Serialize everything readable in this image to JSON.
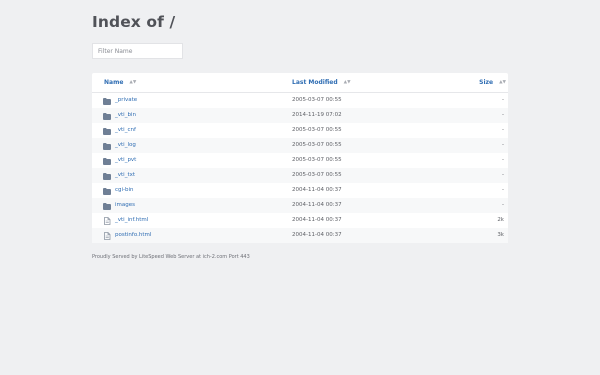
{
  "page": {
    "title": "Index of /"
  },
  "filter": {
    "placeholder": "Filter Name",
    "value": ""
  },
  "table": {
    "columns": {
      "name": "Name",
      "modified": "Last Modified",
      "size": "Size"
    },
    "sort_indicator": "▲▼",
    "rows": [
      {
        "type": "folder",
        "icon": "folder-icon",
        "name": "_private",
        "modified": "2005-03-07 00:55",
        "size": "-"
      },
      {
        "type": "folder",
        "icon": "folder-icon",
        "name": "_vti_bin",
        "modified": "2014-11-19 07:02",
        "size": "-"
      },
      {
        "type": "folder",
        "icon": "folder-icon",
        "name": "_vti_cnf",
        "modified": "2005-03-07 00:55",
        "size": "-"
      },
      {
        "type": "folder",
        "icon": "folder-icon",
        "name": "_vti_log",
        "modified": "2005-03-07 00:55",
        "size": "-"
      },
      {
        "type": "folder",
        "icon": "folder-icon",
        "name": "_vti_pvt",
        "modified": "2005-03-07 00:55",
        "size": "-"
      },
      {
        "type": "folder",
        "icon": "folder-icon",
        "name": "_vti_txt",
        "modified": "2005-03-07 00:55",
        "size": "-"
      },
      {
        "type": "folder",
        "icon": "folder-icon",
        "name": "cgi-bin",
        "modified": "2004-11-04 00:37",
        "size": "-"
      },
      {
        "type": "folder",
        "icon": "folder-icon",
        "name": "images",
        "modified": "2004-11-04 00:37",
        "size": "-"
      },
      {
        "type": "file",
        "icon": "file-icon",
        "name": "_vti_inf.html",
        "modified": "2004-11-04 00:37",
        "size": "2k"
      },
      {
        "type": "file",
        "icon": "file-icon",
        "name": "postinfo.html",
        "modified": "2004-11-04 00:37",
        "size": "3k"
      }
    ]
  },
  "footer": {
    "text": "Proudly Served by LiteSpeed Web Server at ich-2.com Port 443"
  },
  "colors": {
    "background": "#eff0f2",
    "link": "#2f6db3",
    "folder_icon": "#6f7f95",
    "file_icon": "#8d96a3"
  }
}
